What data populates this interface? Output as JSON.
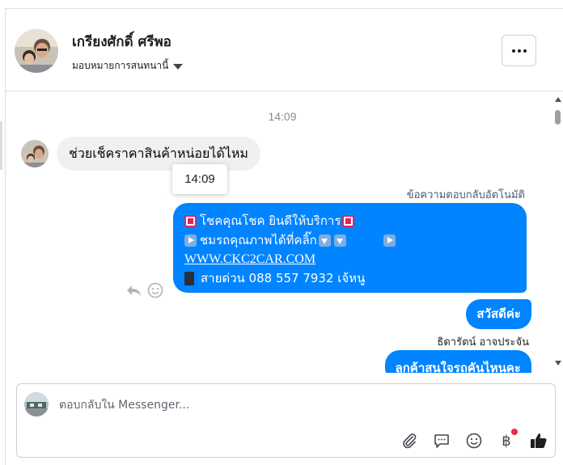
{
  "header": {
    "contact_name": "เกรียงศักดิ์ ศรีพอ",
    "assign_label": "มอบหมายการสนทนานี้",
    "more_label": "More actions"
  },
  "chat": {
    "top_timestamp": "14:09",
    "incoming_message": "ช่วยเช็คราคาสินค้าหน่อยได้ไหม",
    "hover_timestamp": "14:09",
    "auto_reply_label": "ข้อความตอบกลับอัตโนมัติ",
    "auto_reply": {
      "line1_text": "โชคคุณโชค ยินดีให้บริการ",
      "line2_text": "ชมรถคุณภาพได้ที่คลิ๊ก",
      "link": "WWW.CKC2CAR.COM",
      "line4_text": "สายด่วน 088 557 7932 เจ้หนู"
    },
    "greeting": "สวัสดีค่ะ",
    "sender_name": "ธิดารัตน์ อาจประจัน",
    "last_message": "ลูกค้าสนใจรถคันไหนคะ"
  },
  "composer": {
    "placeholder": "ตอบกลับใน Messenger...",
    "baht_symbol": "฿"
  },
  "colors": {
    "messenger_blue": "#0084ff",
    "incoming_gray": "#f0f0f0",
    "notification_red": "#f02849"
  },
  "icons": [
    "more-icon",
    "caret-down-icon",
    "reply-icon",
    "emoji-react-icon",
    "attachment-icon",
    "saved-replies-icon",
    "emoji-icon",
    "baht-icon",
    "like-icon"
  ]
}
